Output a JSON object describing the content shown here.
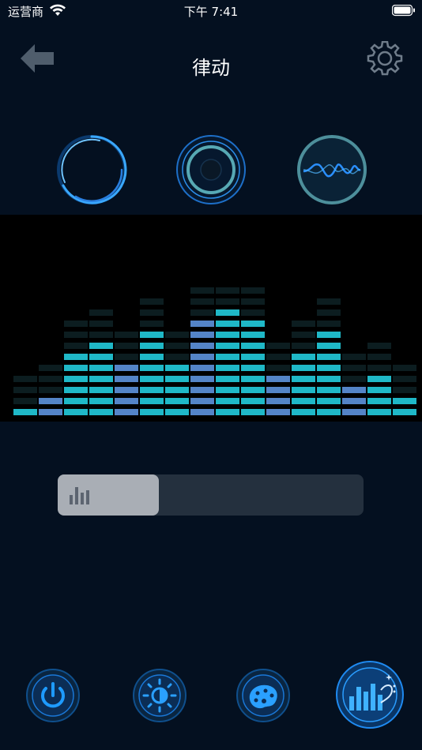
{
  "status_bar": {
    "carrier": "运营商",
    "time": "下午 7:41"
  },
  "nav": {
    "title": "律动",
    "back_icon": "back-arrow-icon",
    "settings_icon": "gear-icon"
  },
  "modes": [
    {
      "id": "spin",
      "icon": "ring-spinner-icon"
    },
    {
      "id": "pulse",
      "icon": "concentric-rings-icon"
    },
    {
      "id": "wave",
      "icon": "sine-wave-icon"
    }
  ],
  "equalizer": {
    "levels": [
      0.1,
      0.2,
      0.47,
      0.55,
      0.4,
      0.68,
      0.45,
      0.72,
      0.87,
      0.75,
      0.35,
      0.5,
      0.68,
      0.22,
      0.3,
      0.18
    ]
  },
  "sensitivity_slider": {
    "value": 0.33,
    "icon": "bars-icon"
  },
  "tabs": [
    {
      "id": "power",
      "icon": "power-icon",
      "active": false
    },
    {
      "id": "brightness",
      "icon": "sun-icon",
      "active": false
    },
    {
      "id": "color",
      "icon": "palette-icon",
      "active": false
    },
    {
      "id": "music",
      "icon": "music-bars-icon",
      "active": true
    }
  ],
  "colors": {
    "background": "#041020",
    "accent": "#1e90ff",
    "eq_cyan": "#22c8d8",
    "eq_blue": "#5b8fd8"
  }
}
